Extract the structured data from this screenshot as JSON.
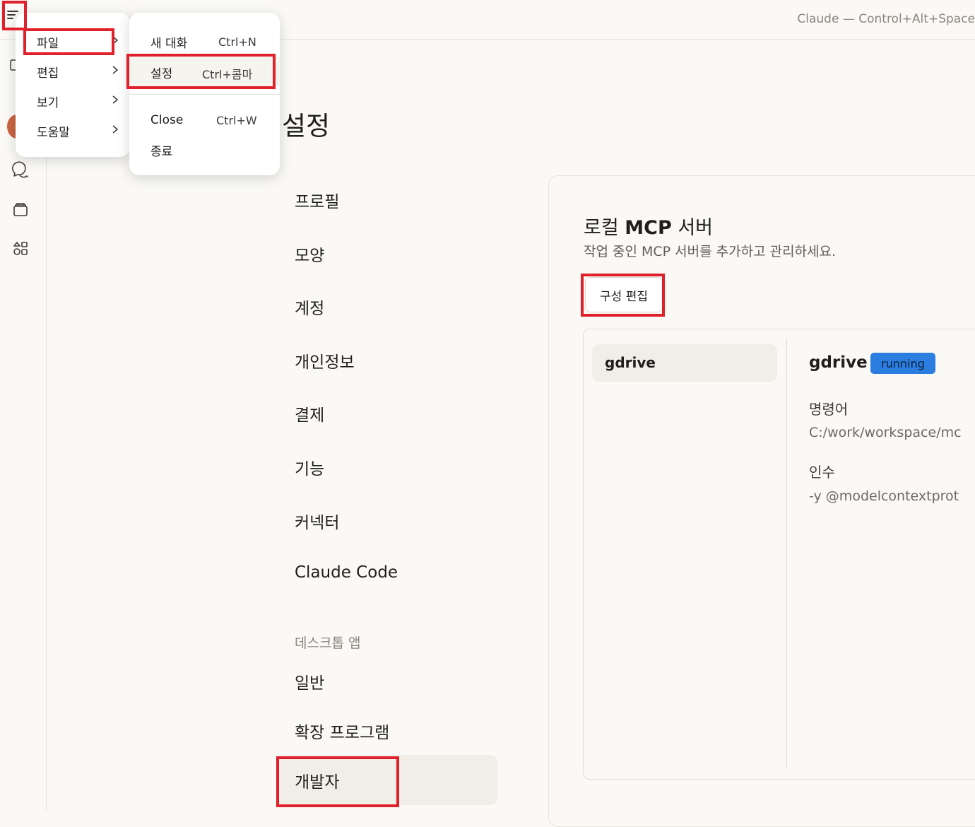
{
  "window": {
    "title": "Claude — Control+Alt+Space"
  },
  "app_menu": {
    "items": [
      {
        "label": "파일"
      },
      {
        "label": "편집"
      },
      {
        "label": "보기"
      },
      {
        "label": "도움말"
      }
    ],
    "file_submenu": [
      {
        "label": "새 대화",
        "shortcut": "Ctrl+N"
      },
      {
        "label": "설정",
        "shortcut": "Ctrl+콤마"
      },
      {
        "label": "Close",
        "shortcut": "Ctrl+W"
      },
      {
        "label": "종료",
        "shortcut": ""
      }
    ]
  },
  "settings": {
    "title": "설정",
    "nav": [
      "프로필",
      "모양",
      "계정",
      "개인정보",
      "결제",
      "기능",
      "커넥터",
      "Claude Code"
    ],
    "desktop_section": "데스크톱 앱",
    "desktop_nav": [
      "일반",
      "확장 프로그램",
      "개발자"
    ]
  },
  "mcp": {
    "title_prefix": "로컬 ",
    "title_bold": "MCP",
    "title_suffix": " 서버",
    "description": "작업 중인 MCP 서버를 추가하고 관리하세요.",
    "edit_button": "구성 편집",
    "server_list": [
      "gdrive"
    ],
    "detail": {
      "name": "gdrive",
      "status": "running",
      "command_label": "명령어",
      "command_value": "C:/work/workspace/mc",
      "args_label": "인수",
      "args_value": "-y @modelcontextprot"
    }
  },
  "colors": {
    "accent_red": "#e0202a",
    "status_blue": "#2b7de0",
    "avatar": "#c96442"
  }
}
